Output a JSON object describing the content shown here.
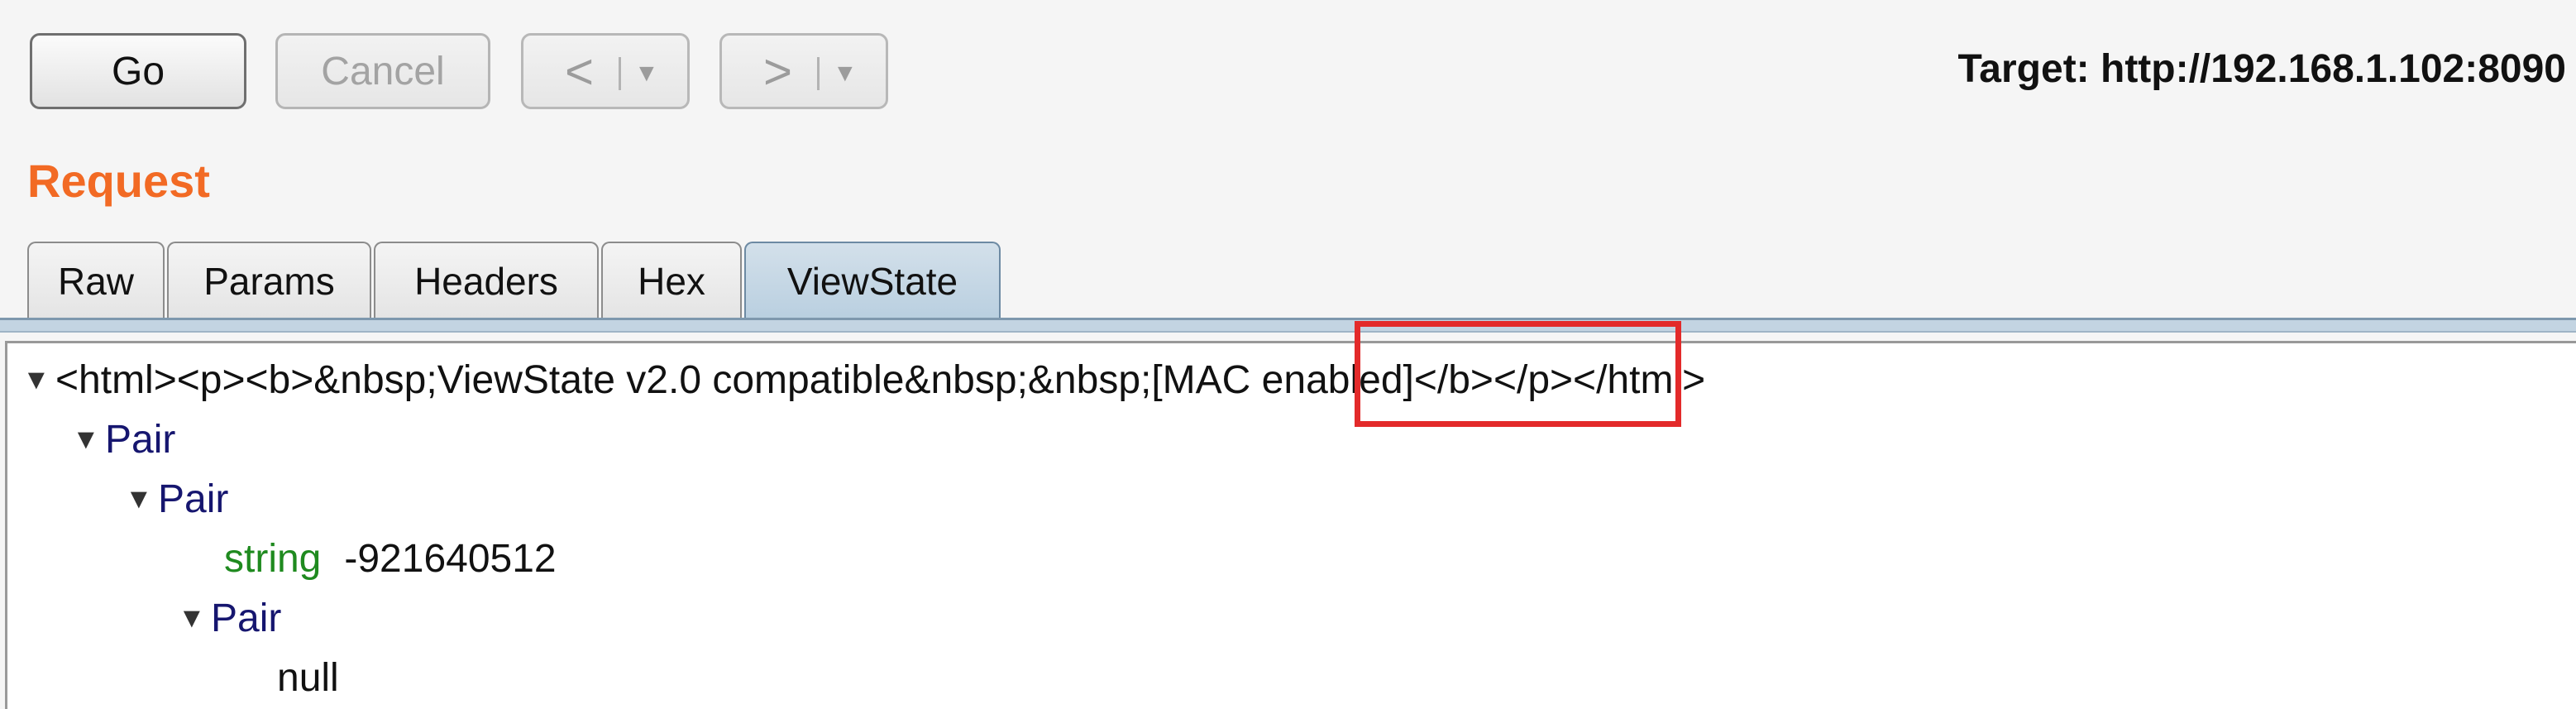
{
  "toolbar": {
    "go_label": "Go",
    "cancel_label": "Cancel",
    "back_arrow": "<",
    "forward_arrow": ">",
    "dropdown_glyph": "▼",
    "target_text": "Target: http://192.168.1.102:8090"
  },
  "request": {
    "title": "Request",
    "tabs": [
      {
        "label": "Raw"
      },
      {
        "label": "Params"
      },
      {
        "label": "Headers"
      },
      {
        "label": "Hex"
      },
      {
        "label": "ViewState"
      }
    ],
    "active_tab": "ViewState"
  },
  "tree": {
    "caret": "▼",
    "root": {
      "text_before": "<html><p><b>&nbsp;ViewState v2.0 compatible&nbsp;&nbsp;",
      "mac_text": "[MAC enabled]",
      "text_after": "</b></p></html>"
    },
    "pair_label": "Pair",
    "string_type": "string",
    "string_value": "-921640512",
    "null_value": "null"
  },
  "colors": {
    "request_title": "#f26a24",
    "pair_node": "#16166f",
    "type_label": "#1f8a1f",
    "highlight_box": "#e32a2a"
  }
}
